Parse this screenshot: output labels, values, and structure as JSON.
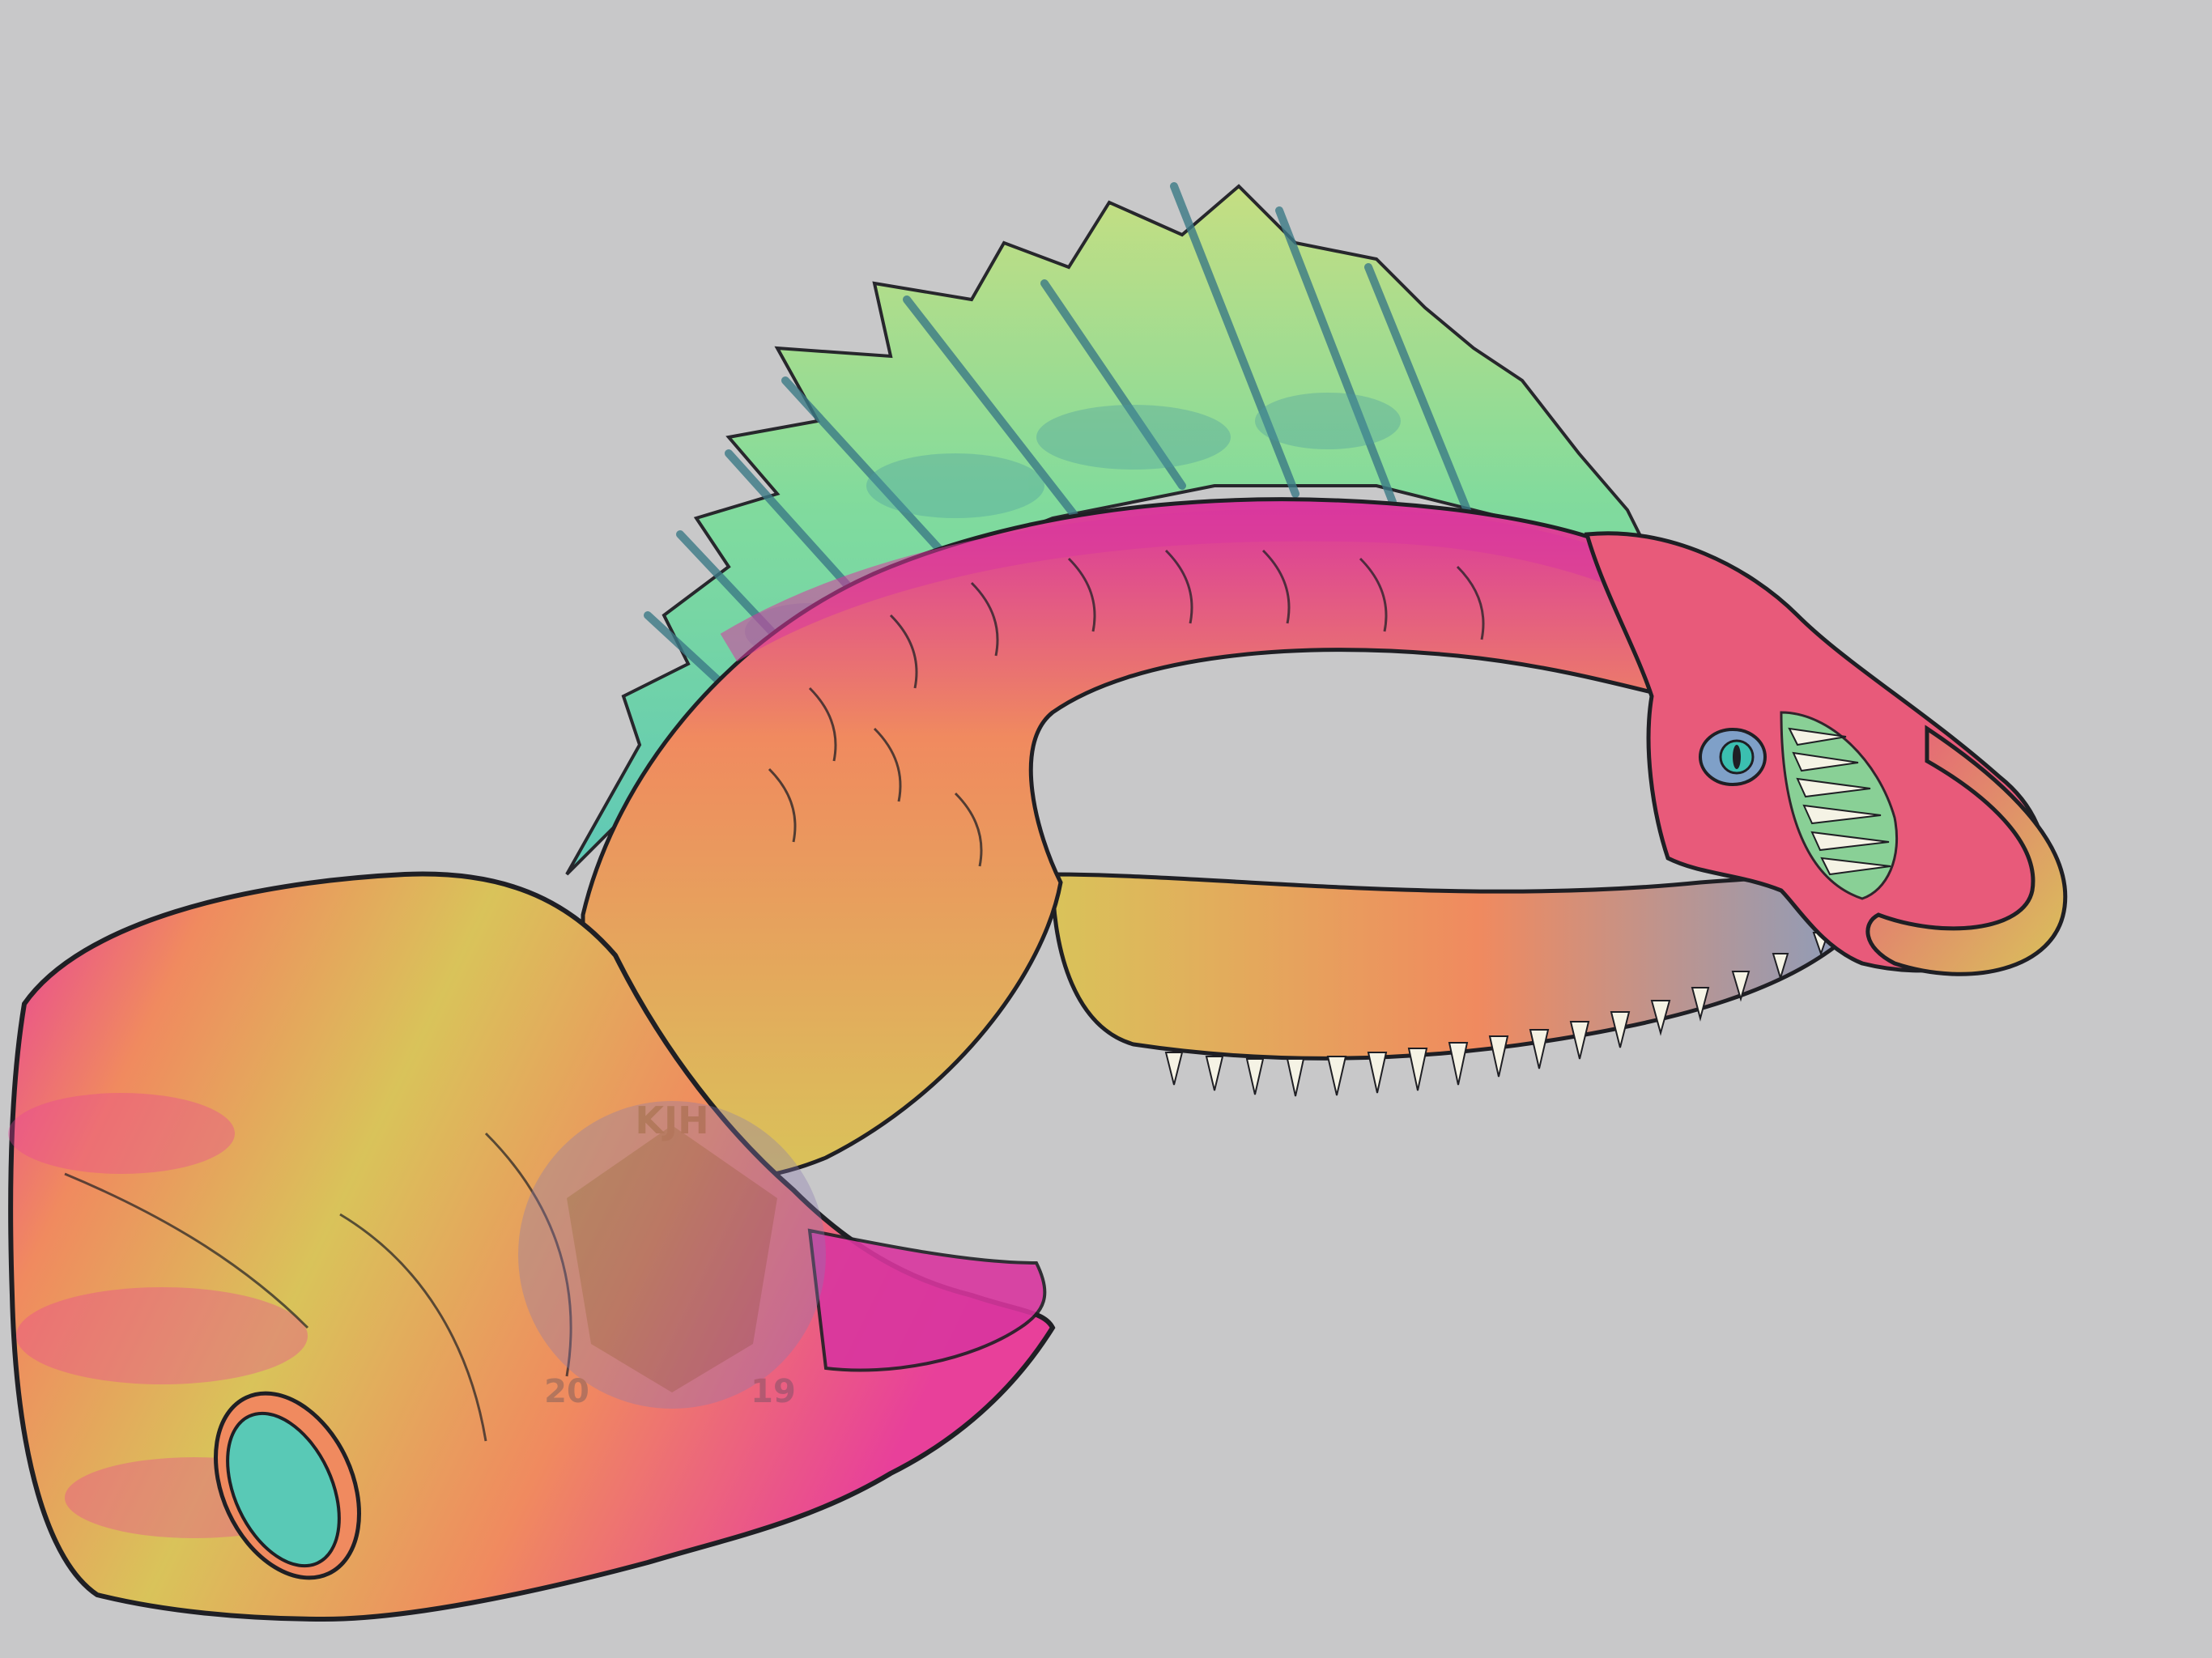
{
  "artwork": {
    "subject": "creature-illustration",
    "background_color": "#c8c8c9",
    "palette": {
      "pink": "#e8409a",
      "magenta": "#d9369f",
      "orange": "#f08a5f",
      "yellow": "#d9c35a",
      "green": "#a7e07f",
      "teal": "#59c9b6",
      "blue": "#7fa0c8",
      "outline": "#1f1f24",
      "bone": "#efeedd"
    }
  },
  "watermark": {
    "monogram": "KJH",
    "year_left": "20",
    "year_right": "19"
  }
}
